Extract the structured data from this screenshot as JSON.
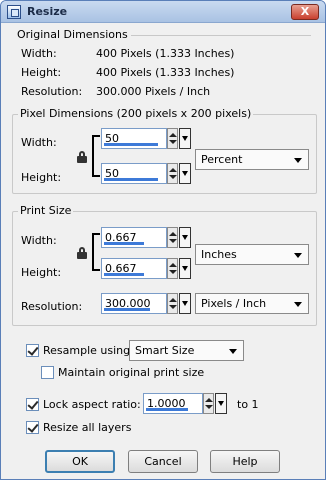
{
  "window": {
    "title": "Resize",
    "close_glyph": "X"
  },
  "original": {
    "title": "Original Dimensions",
    "rows": [
      {
        "label": "Width:",
        "value": "400 Pixels (1.333 Inches)"
      },
      {
        "label": "Height:",
        "value": "400 Pixels (1.333 Inches)"
      },
      {
        "label": "Resolution:",
        "value": "300.000 Pixels / Inch"
      }
    ]
  },
  "pixel_dimensions": {
    "title": "Pixel Dimensions (200 pixels x 200 pixels)",
    "width_label": "Width:",
    "height_label": "Height:",
    "width_value": "50",
    "height_value": "50",
    "unit": "Percent"
  },
  "print_size": {
    "title": "Print Size",
    "width_label": "Width:",
    "height_label": "Height:",
    "width_value": "0.667",
    "height_value": "0.667",
    "unit": "Inches",
    "resolution_label": "Resolution:",
    "resolution_value": "300.000",
    "resolution_unit": "Pixels / Inch"
  },
  "options": {
    "resample_label": "Resample using:",
    "resample_checked": true,
    "resample_method": "Smart Size",
    "maintain_label": "Maintain original print size",
    "maintain_checked": false,
    "lock_aspect_label": "Lock aspect ratio:",
    "lock_aspect_checked": true,
    "aspect_value": "1.0000",
    "aspect_suffix": "to 1",
    "resize_all_label": "Resize all layers",
    "resize_all_checked": true
  },
  "buttons": {
    "ok": "OK",
    "cancel": "Cancel",
    "help": "Help"
  },
  "icons": {
    "app": "resize-app-icon",
    "lock": "lock-icon"
  },
  "colors": {
    "titlebar": "#a9c2e3",
    "focus_border": "#7a9cc8",
    "accent_bar": "#3d7ad8",
    "default_button_border": "#3c7fb1"
  }
}
